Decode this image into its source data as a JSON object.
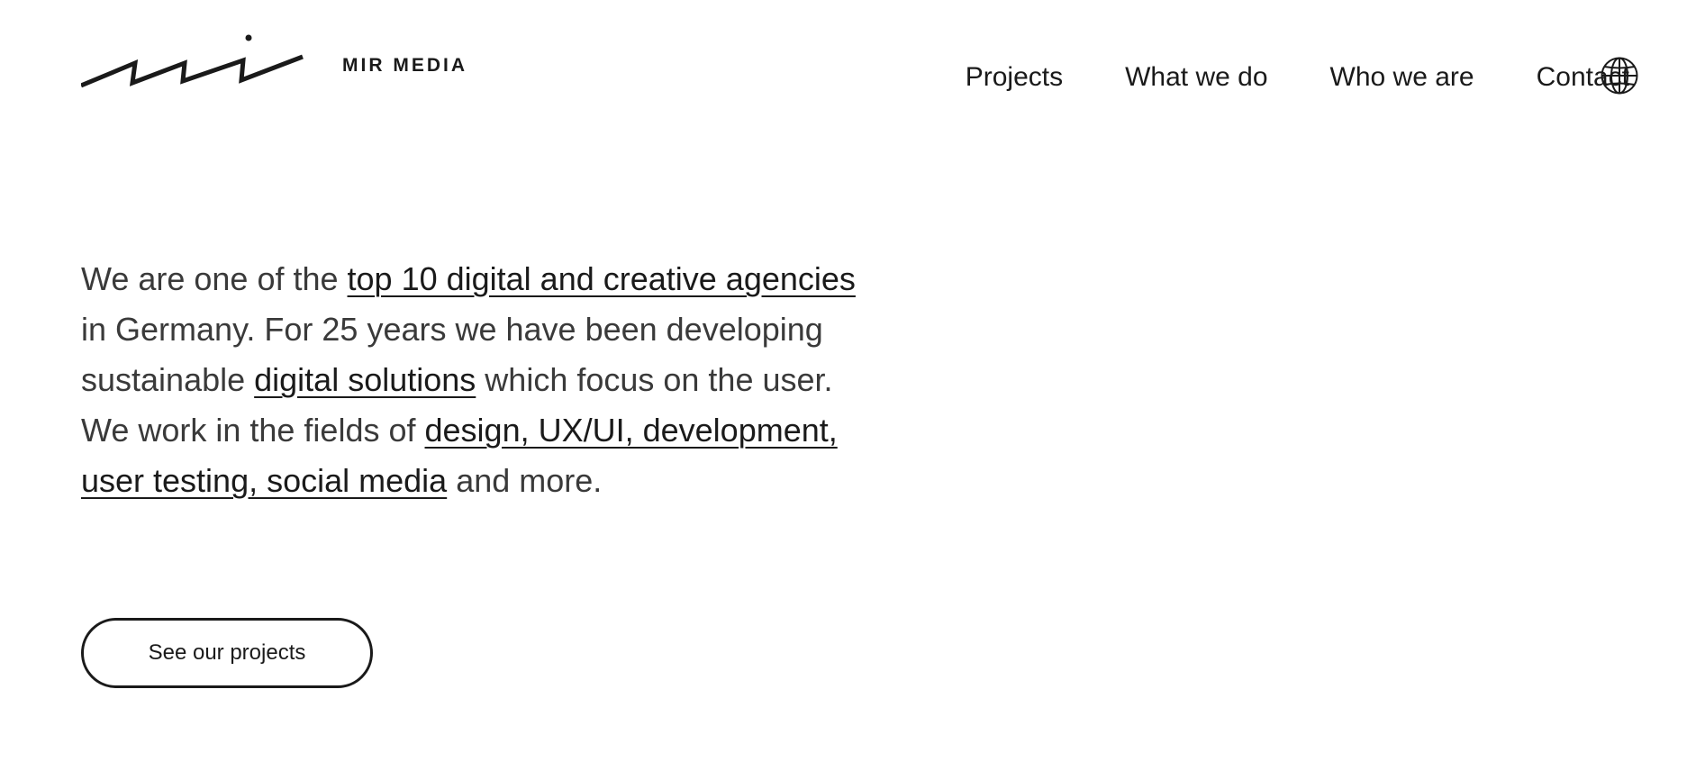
{
  "brand": {
    "name": "MIR MEDIA",
    "logo_icon": "mir-media-wave-logo"
  },
  "nav": {
    "items": [
      {
        "label": "Projects"
      },
      {
        "label": "What we do"
      },
      {
        "label": "Who we are"
      },
      {
        "label": "Contact"
      }
    ],
    "language_icon": "globe-icon"
  },
  "intro": {
    "t1": "We are one of the ",
    "link_top10": "top 10 digital and creative agencies",
    "t2": " in Germany. For 25 years we have been developing sustainable ",
    "link_solutions": "digital solutions",
    "t3": " which focus on the user. We work in the fields of ",
    "link_fields": "design, UX/UI, development, user testing, social media",
    "t4": " and more."
  },
  "cta": {
    "label": "See our projects"
  },
  "colors": {
    "text": "#1a1a1a",
    "body_text": "#3a3a3a",
    "background": "#ffffff"
  }
}
